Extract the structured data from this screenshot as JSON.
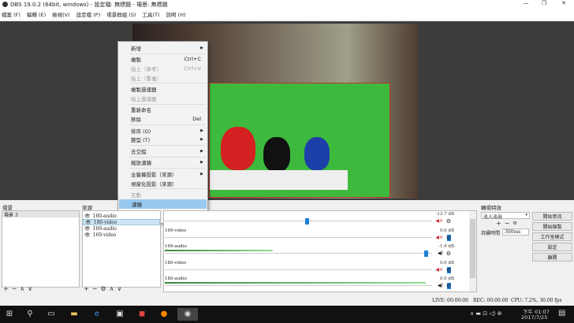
{
  "window": {
    "title": "OBS 19.0.2 (64bit, windows) - 設定檔: 無標題 - 場景: 無標題"
  },
  "menubar": [
    "檔案 (F)",
    "編輯 (E)",
    "檢視(V)",
    "設定檔 (P)",
    "場景群組 (S)",
    "工具(T)",
    "說明 (H)"
  ],
  "context_menu": [
    {
      "label": "新增",
      "submenu": true
    },
    {
      "sep": true
    },
    {
      "label": "複製",
      "shortcut": "Ctrl+C"
    },
    {
      "label": "貼上（參考）",
      "shortcut": "Ctrl+V",
      "disabled": true
    },
    {
      "label": "貼上（重複）",
      "disabled": true
    },
    {
      "sep": true
    },
    {
      "label": "複製過濾器"
    },
    {
      "label": "貼上過濾器",
      "disabled": true
    },
    {
      "sep": true
    },
    {
      "label": "重新命名"
    },
    {
      "label": "移除",
      "shortcut": "Del"
    },
    {
      "sep": true
    },
    {
      "label": "排序 (O)",
      "submenu": true
    },
    {
      "label": "變型 (T)",
      "submenu": true
    },
    {
      "sep": true
    },
    {
      "label": "去交錯",
      "submenu": true
    },
    {
      "sep": true
    },
    {
      "label": "縮放濾鏡",
      "submenu": true
    },
    {
      "sep": true
    },
    {
      "label": "全螢幕投影（來源）",
      "submenu": true
    },
    {
      "label": "視窗化投影（來源）"
    },
    {
      "sep": true
    },
    {
      "label": "互動",
      "disabled": true
    },
    {
      "label": "濾鏡",
      "highlighted": true
    },
    {
      "label": "屬性"
    }
  ],
  "scenes": {
    "label": "場景",
    "items": [
      "場景 3"
    ]
  },
  "sources": {
    "label": "來源",
    "items": [
      "180-audio",
      "180-video",
      "169-audio",
      "169-video"
    ],
    "selected": 1
  },
  "mixer": [
    {
      "name": "",
      "db": "-13.7 dB",
      "volume": 0.5,
      "muted": true,
      "level": 0
    },
    {
      "name": "169-video",
      "db": "0.0 dB",
      "volume": 1.0,
      "muted": true,
      "level": 0
    },
    {
      "name": "169-audio",
      "db": "-1.9 dB",
      "volume": 0.92,
      "muted": false,
      "level": 0.38
    },
    {
      "name": "180-video",
      "db": "0.0 dB",
      "volume": 1.0,
      "muted": true,
      "level": 0
    },
    {
      "name": "180-audio",
      "db": "0.0 dB",
      "volume": 1.0,
      "muted": false,
      "level": 0.92
    }
  ],
  "transitions": {
    "label": "轉場特效",
    "selected": "淡入淡出",
    "duration_label": "持續時間",
    "duration": "300ms"
  },
  "controls": [
    "開始串流",
    "開始錄製",
    "工作室模式",
    "設定",
    "離開"
  ],
  "status": {
    "live": "LIVE: 00:00:00",
    "rec": "REC: 00:00:00",
    "cpu": "CPU: 7.2%, 30.00 fps"
  },
  "taskbar": {
    "time": "下午 01:07",
    "date": "2017/7/25"
  },
  "colors": {
    "accent": "#1e7fd6",
    "highlight": "#99c9ef",
    "muted": "#d32020"
  }
}
